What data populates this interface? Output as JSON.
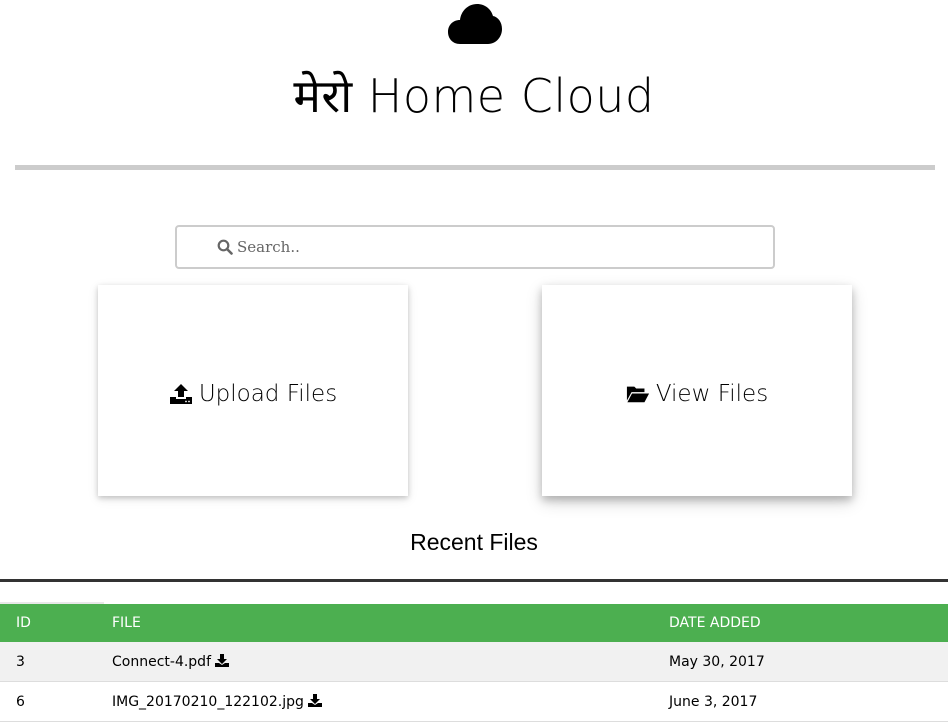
{
  "header": {
    "title": "मेरो Home Cloud",
    "logo_icon": "cloud-icon"
  },
  "search": {
    "placeholder": "Search..",
    "value": "",
    "icon": "search-icon"
  },
  "actions": {
    "upload": {
      "label": "Upload Files",
      "icon": "upload-icon"
    },
    "view": {
      "label": "View Files",
      "icon": "folder-open-icon"
    }
  },
  "recent": {
    "heading": "Recent Files",
    "columns": {
      "id": "ID",
      "file": "FILE",
      "date": "DATE ADDED"
    },
    "rows": [
      {
        "id": "3",
        "file": "Connect-4.pdf",
        "date": "May 30, 2017",
        "icon": "download-icon"
      },
      {
        "id": "6",
        "file": "IMG_20170210_122102.jpg",
        "date": "June 3, 2017",
        "icon": "download-icon"
      }
    ]
  },
  "colors": {
    "accent": "#4caf50",
    "rule": "#cccccc",
    "row_stripe": "#f1f1f1"
  }
}
